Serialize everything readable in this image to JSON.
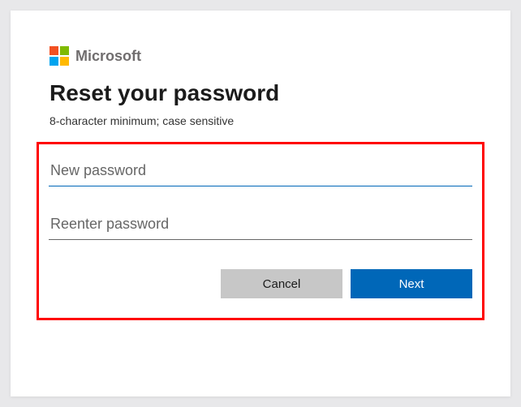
{
  "brand": {
    "name": "Microsoft",
    "colors": {
      "tile_red": "#f25022",
      "tile_green": "#7fba00",
      "tile_blue": "#00a4ef",
      "tile_yellow": "#ffb900"
    }
  },
  "page": {
    "title": "Reset your password",
    "subtitle": "8-character minimum; case sensitive"
  },
  "form": {
    "new_password": {
      "placeholder": "New password",
      "value": ""
    },
    "reenter_password": {
      "placeholder": "Reenter password",
      "value": ""
    }
  },
  "buttons": {
    "cancel": "Cancel",
    "next": "Next"
  },
  "accent_color": "#0067b8"
}
